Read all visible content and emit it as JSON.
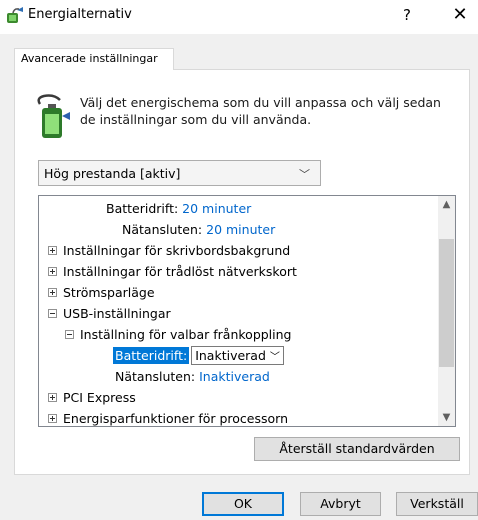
{
  "window": {
    "title": "Energialternativ",
    "help": "?",
    "close": "✕"
  },
  "tab": {
    "label": "Avancerade inställningar"
  },
  "description": "Välj det energischema som du vill anpassa och välj sedan de inställningar som du vill använda.",
  "plan_select": {
    "value": "Hög prestanda [aktiv]"
  },
  "tree": {
    "rows": [
      {
        "label": "Batteridrift:",
        "value": "20 minuter"
      },
      {
        "label": "Nätansluten:",
        "value": "20 minuter"
      },
      {
        "label": "Inställningar för skrivbordsbakgrund"
      },
      {
        "label": "Inställningar för trådlöst nätverkskort"
      },
      {
        "label": "Strömsparläge"
      },
      {
        "label": "USB-inställningar"
      },
      {
        "label": "Inställning för valbar frånkoppling"
      },
      {
        "label": "Batteridrift:",
        "value": "Inaktiverad"
      },
      {
        "label": "Nätansluten:",
        "value": "Inaktiverad"
      },
      {
        "label": "PCI Express"
      },
      {
        "label": "Energisparfunktioner för processorn"
      }
    ]
  },
  "buttons": {
    "restore": "Återställ standardvärden",
    "ok": "OK",
    "cancel": "Avbryt",
    "apply": "Verkställ"
  },
  "icons": {
    "app": "power-options-icon",
    "plan": "battery-plug-icon",
    "dropdown": "chevron-down-icon"
  },
  "colors": {
    "accent": "#0078d7",
    "link_value": "#0066cc"
  }
}
